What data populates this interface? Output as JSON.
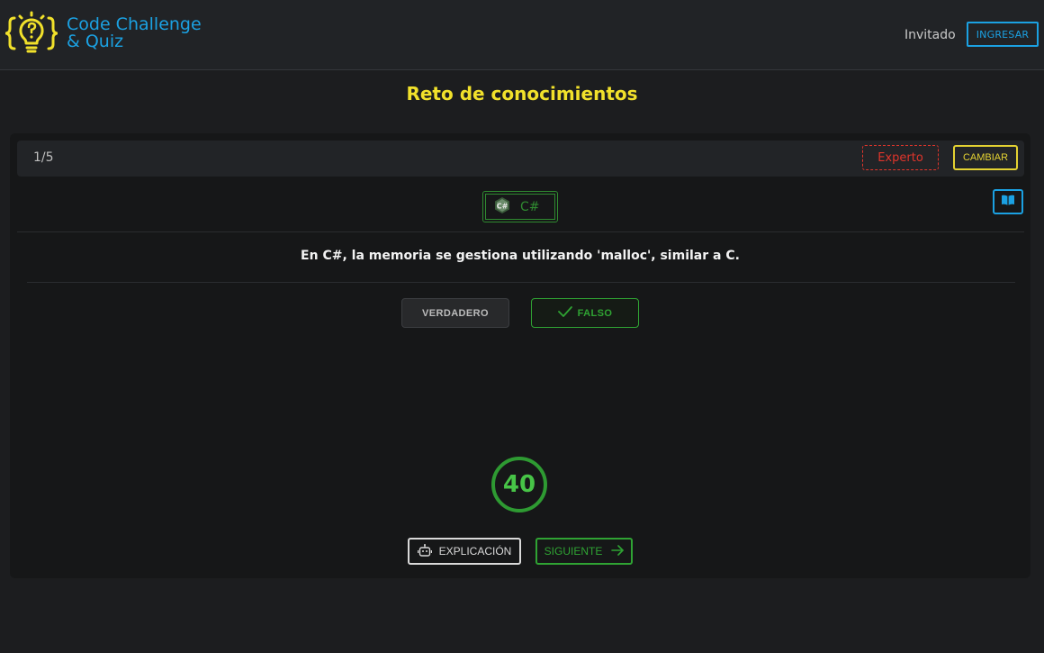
{
  "header": {
    "brand_line1": "Code Challenge",
    "brand_line2": "& Quiz",
    "user_label": "Invitado",
    "login_label": "INGRESAR",
    "logo_icon": "lightbulb-question-icon"
  },
  "page": {
    "title": "Reto de conocimientos"
  },
  "quiz": {
    "counter": "1/5",
    "level": "Experto",
    "change_label": "CAMBIAR",
    "language": "C#",
    "language_icon": "csharp-icon",
    "book_icon": "book-icon",
    "question": "En C#, la memoria se gestiona utilizando 'malloc', similar a C.",
    "option_true": "VERDADERO",
    "option_false": "FALSO",
    "selected_option": "FALSO",
    "timer": "40",
    "explain_label": "EXPLICACIÓN",
    "next_label": "SIGUIENTE"
  },
  "colors": {
    "accent_blue": "#1ba1e2",
    "accent_yellow": "#f1e12b",
    "danger_red": "#e0352b",
    "success_green": "#2fa333",
    "background": "#1c1d1f"
  }
}
